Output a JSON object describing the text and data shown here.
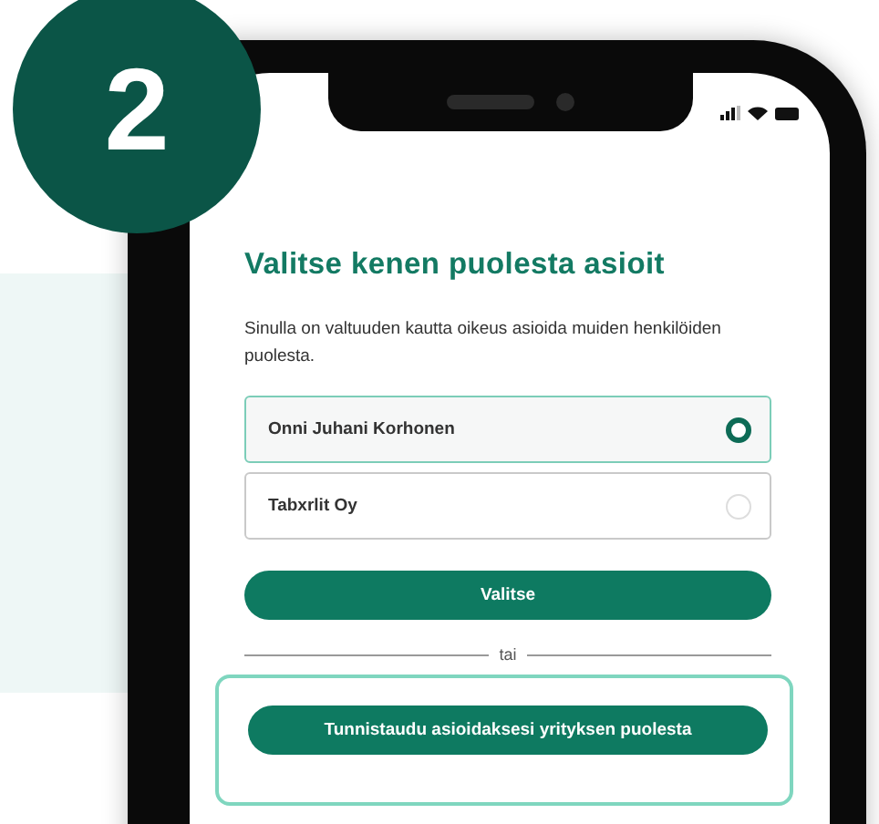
{
  "step_badge": "2",
  "screen": {
    "title": "Valitse kenen puolesta asioit",
    "description": "Sinulla on valtuuden kautta oikeus asioida muiden henkilöiden puolesta.",
    "options": [
      {
        "label": "Onni Juhani Korhonen",
        "selected": true
      },
      {
        "label": "Tabxrlit Oy",
        "selected": false
      }
    ],
    "choose_button": "Valitse",
    "divider": "tai",
    "company_button": "Tunnistaudu asioidaksesi yrityksen puolesta"
  }
}
